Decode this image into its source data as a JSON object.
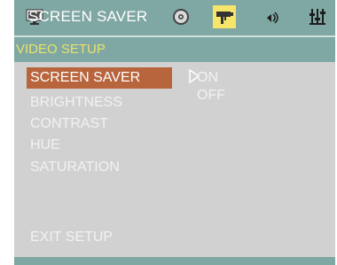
{
  "tabs": {
    "screen_saver_label": "SCREEN SAVER",
    "icons": [
      "monitor-icon",
      "disc-icon",
      "camera-icon",
      "speaker-icon",
      "settings-sliders-icon"
    ]
  },
  "section": {
    "title": "VIDEO SETUP"
  },
  "menu": {
    "items": [
      {
        "label": "SCREEN SAVER",
        "selected": true
      },
      {
        "label": "BRIGHTNESS",
        "selected": false
      },
      {
        "label": "CONTRAST",
        "selected": false
      },
      {
        "label": "HUE",
        "selected": false
      },
      {
        "label": "SATURATION",
        "selected": false
      }
    ],
    "exit_label": "EXIT SETUP"
  },
  "options": {
    "values": [
      "ON",
      "OFF"
    ]
  },
  "colors": {
    "header_teal": "#7fa7a3",
    "body_gray": "#d1d1d1",
    "highlight": "#b8653d",
    "section_text": "#e9e36b"
  }
}
